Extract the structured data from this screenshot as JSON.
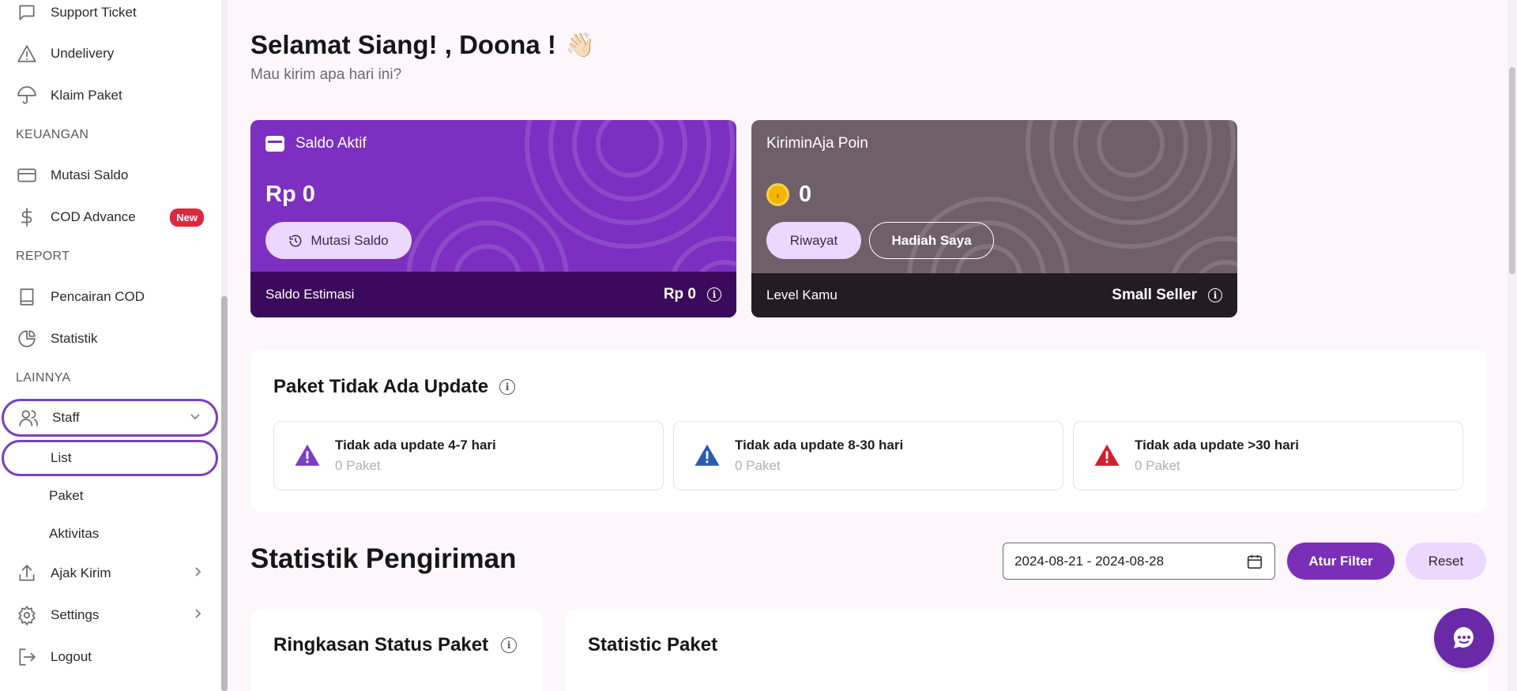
{
  "sidebar": {
    "items_top": [
      {
        "label": "Support Ticket",
        "icon": "chat-icon"
      },
      {
        "label": "Undelivery",
        "icon": "warning-icon"
      },
      {
        "label": "Klaim Paket",
        "icon": "umbrella-icon"
      }
    ],
    "section_keuangan": "KEUANGAN",
    "items_keuangan": [
      {
        "label": "Mutasi Saldo",
        "icon": "card-icon"
      },
      {
        "label": "COD Advance",
        "icon": "dollar-icon",
        "badge": "New"
      }
    ],
    "section_report": "REPORT",
    "items_report": [
      {
        "label": "Pencairan COD",
        "icon": "book-icon"
      },
      {
        "label": "Statistik",
        "icon": "pie-chart-icon"
      }
    ],
    "section_lainnya": "LAINNYA",
    "staff": {
      "label": "Staff",
      "icon": "users-icon"
    },
    "staff_sub": [
      "List",
      "Paket",
      "Aktivitas"
    ],
    "items_bottom": [
      {
        "label": "Ajak Kirim",
        "icon": "share-icon"
      },
      {
        "label": "Settings",
        "icon": "gear-icon"
      },
      {
        "label": "Logout",
        "icon": "logout-icon"
      }
    ]
  },
  "header": {
    "greeting": "Selamat Siang! , Doona !",
    "wave": "👋🏻",
    "subtitle": "Mau kirim apa hari ini?"
  },
  "saldo_card": {
    "title": "Saldo Aktif",
    "amount": "Rp 0",
    "button": "Mutasi Saldo",
    "footer_label": "Saldo Estimasi",
    "footer_value": "Rp 0",
    "color": "#7c2fc0"
  },
  "poin_card": {
    "title": "KiriminAja Poin",
    "amount": "0",
    "btn_history": "Riwayat",
    "btn_rewards": "Hadiah Saya",
    "footer_label": "Level Kamu",
    "footer_value": "Small Seller",
    "color": "#6e5f69"
  },
  "paket_panel": {
    "title": "Paket Tidak Ada Update",
    "boxes": [
      {
        "title": "Tidak ada update 4-7 hari",
        "count": "0 Paket",
        "color": "#7b3fbf"
      },
      {
        "title": "Tidak ada update 8-30 hari",
        "count": "0 Paket",
        "color": "#2a5db0"
      },
      {
        "title": "Tidak ada update >30 hari",
        "count": "0 Paket",
        "color": "#d0202e"
      }
    ]
  },
  "statistik": {
    "title": "Statistik Pengiriman",
    "date_range": "2024-08-21 - 2024-08-28",
    "filter_btn": "Atur Filter",
    "reset_btn": "Reset",
    "card1_title": "Ringkasan Status Paket",
    "card2_title": "Statistic Paket"
  }
}
